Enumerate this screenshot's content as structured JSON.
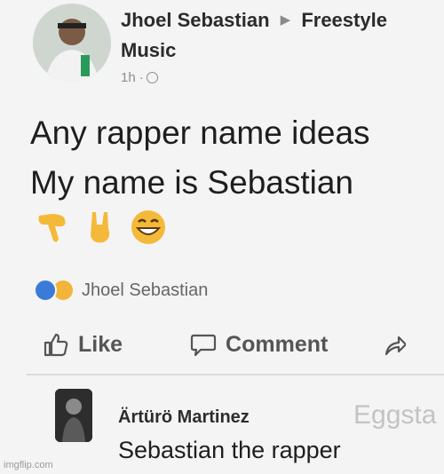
{
  "post": {
    "author": "Jhoel Sebastian",
    "group_line1": "Freestyle",
    "group_line2": "Music",
    "time": "1h ·",
    "text_line1": "Any rapper name ideas",
    "text_line2": "My name is Sebastian",
    "emojis": [
      "pointing-down-emoji",
      "rock-hand-emoji",
      "grinning-face-emoji"
    ]
  },
  "reactions": {
    "types": [
      "like-reaction-icon",
      "haha-reaction-icon"
    ],
    "names": "Jhoel Sebastian"
  },
  "actions": {
    "like_label": "Like",
    "comment_label": "Comment"
  },
  "comment": {
    "author": "Ärtürö Martinez",
    "text": "Sebastian the rapper"
  },
  "overlay": {
    "watermark": "Eggsta",
    "credit": "imgflip.com"
  },
  "colors": {
    "like_blue": "#3b7bd8",
    "haha_yellow": "#f2b53a",
    "background": "#f4f4f4"
  }
}
